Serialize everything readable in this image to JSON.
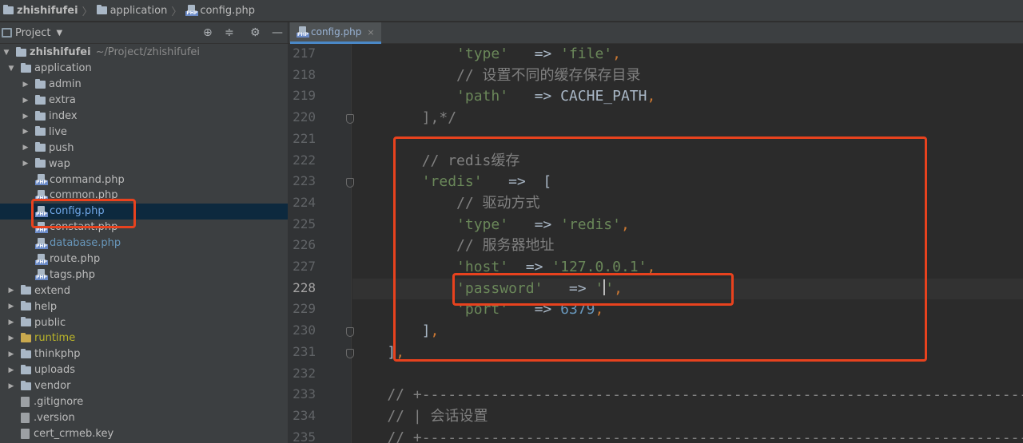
{
  "breadcrumb": [
    "zhishifufei",
    "application",
    "config.php"
  ],
  "project_panel": {
    "title": "Project",
    "root": {
      "name": "zhishifufei",
      "path": "~/Project/zhishifufei"
    },
    "tree": [
      {
        "label": "application",
        "type": "folder",
        "level": 1,
        "expanded": true
      },
      {
        "label": "admin",
        "type": "folder",
        "level": 2
      },
      {
        "label": "extra",
        "type": "folder",
        "level": 2
      },
      {
        "label": "index",
        "type": "folder",
        "level": 2
      },
      {
        "label": "live",
        "type": "folder",
        "level": 2
      },
      {
        "label": "push",
        "type": "folder",
        "level": 2
      },
      {
        "label": "wap",
        "type": "folder",
        "level": 2
      },
      {
        "label": "command.php",
        "type": "php",
        "level": 2
      },
      {
        "label": "common.php",
        "type": "php",
        "level": 2
      },
      {
        "label": "config.php",
        "type": "php",
        "level": 2,
        "selected": true
      },
      {
        "label": "constant.php",
        "type": "php",
        "level": 2
      },
      {
        "label": "database.php",
        "type": "php",
        "level": 2,
        "color": "blue"
      },
      {
        "label": "route.php",
        "type": "php",
        "level": 2
      },
      {
        "label": "tags.php",
        "type": "php",
        "level": 2
      },
      {
        "label": "extend",
        "type": "folder",
        "level": 1
      },
      {
        "label": "help",
        "type": "folder",
        "level": 1
      },
      {
        "label": "public",
        "type": "folder",
        "level": 1
      },
      {
        "label": "runtime",
        "type": "folder",
        "level": 1,
        "color": "yellow"
      },
      {
        "label": "thinkphp",
        "type": "folder",
        "level": 1
      },
      {
        "label": "uploads",
        "type": "folder",
        "level": 1
      },
      {
        "label": "vendor",
        "type": "folder",
        "level": 1
      },
      {
        "label": ".gitignore",
        "type": "file",
        "level": 1
      },
      {
        "label": ".version",
        "type": "file",
        "level": 1
      },
      {
        "label": "cert_crmeb.key",
        "type": "file",
        "level": 1
      }
    ]
  },
  "editor": {
    "tab": {
      "label": "config.php",
      "close": "×"
    },
    "current_line": 228,
    "lines": [
      {
        "n": 217,
        "code": [
          [
            "            ",
            "k"
          ],
          [
            "'type'",
            "s"
          ],
          [
            "   => ",
            "k"
          ],
          [
            "'file'",
            "s"
          ],
          [
            ",",
            "o"
          ]
        ]
      },
      {
        "n": 218,
        "code": [
          [
            "            ",
            "k"
          ],
          [
            "// 设置不同的缓存保存目录",
            "c"
          ]
        ]
      },
      {
        "n": 219,
        "code": [
          [
            "            ",
            "k"
          ],
          [
            "'path'",
            "s"
          ],
          [
            "   => CACHE_PATH",
            "k"
          ],
          [
            ",",
            "o"
          ]
        ]
      },
      {
        "n": 220,
        "code": [
          [
            "        ],*/",
            "c"
          ]
        ]
      },
      {
        "n": 221,
        "code": []
      },
      {
        "n": 222,
        "code": [
          [
            "        ",
            "k"
          ],
          [
            "// redis缓存",
            "c"
          ]
        ]
      },
      {
        "n": 223,
        "code": [
          [
            "        ",
            "k"
          ],
          [
            "'redis'",
            "s"
          ],
          [
            "   =>  [",
            "k"
          ]
        ]
      },
      {
        "n": 224,
        "code": [
          [
            "            ",
            "k"
          ],
          [
            "// 驱动方式",
            "c"
          ]
        ]
      },
      {
        "n": 225,
        "code": [
          [
            "            ",
            "k"
          ],
          [
            "'type'",
            "s"
          ],
          [
            "   => ",
            "k"
          ],
          [
            "'redis'",
            "s"
          ],
          [
            ",",
            "o"
          ]
        ]
      },
      {
        "n": 226,
        "code": [
          [
            "            ",
            "k"
          ],
          [
            "// 服务器地址",
            "c"
          ]
        ]
      },
      {
        "n": 227,
        "code": [
          [
            "            ",
            "k"
          ],
          [
            "'host'",
            "s"
          ],
          [
            "  => ",
            "k"
          ],
          [
            "'127.0.0.1'",
            "s"
          ],
          [
            ",",
            "o"
          ]
        ]
      },
      {
        "n": 228,
        "code": [
          [
            "            ",
            "k"
          ],
          [
            "'password'",
            "s"
          ],
          [
            "   => ",
            "k"
          ],
          [
            "'",
            "s"
          ],
          [
            "|",
            "caret"
          ],
          [
            "'",
            "s"
          ],
          [
            ",",
            "o"
          ]
        ]
      },
      {
        "n": 229,
        "code": [
          [
            "            ",
            "k"
          ],
          [
            "'port'",
            "s"
          ],
          [
            "   => ",
            "k"
          ],
          [
            "6379",
            "n"
          ],
          [
            ",",
            "o"
          ]
        ]
      },
      {
        "n": 230,
        "code": [
          [
            "        ]",
            "k"
          ],
          [
            ",",
            "o"
          ]
        ]
      },
      {
        "n": 231,
        "code": [
          [
            "    ]",
            "k"
          ],
          [
            ",",
            "o"
          ]
        ]
      },
      {
        "n": 232,
        "code": []
      },
      {
        "n": 233,
        "code": [
          [
            "    // +----------------------------------------------------------------------",
            "c"
          ]
        ]
      },
      {
        "n": 234,
        "code": [
          [
            "    // | 会话设置",
            "c"
          ]
        ]
      },
      {
        "n": 235,
        "code": [
          [
            "    // +----------------------------------------------------------------------",
            "c"
          ]
        ]
      }
    ]
  },
  "colors": {
    "annotation": "#e8421e",
    "string": "#6a8759",
    "comment": "#808080",
    "number": "#6897bb",
    "keyword": "#cc7832"
  }
}
